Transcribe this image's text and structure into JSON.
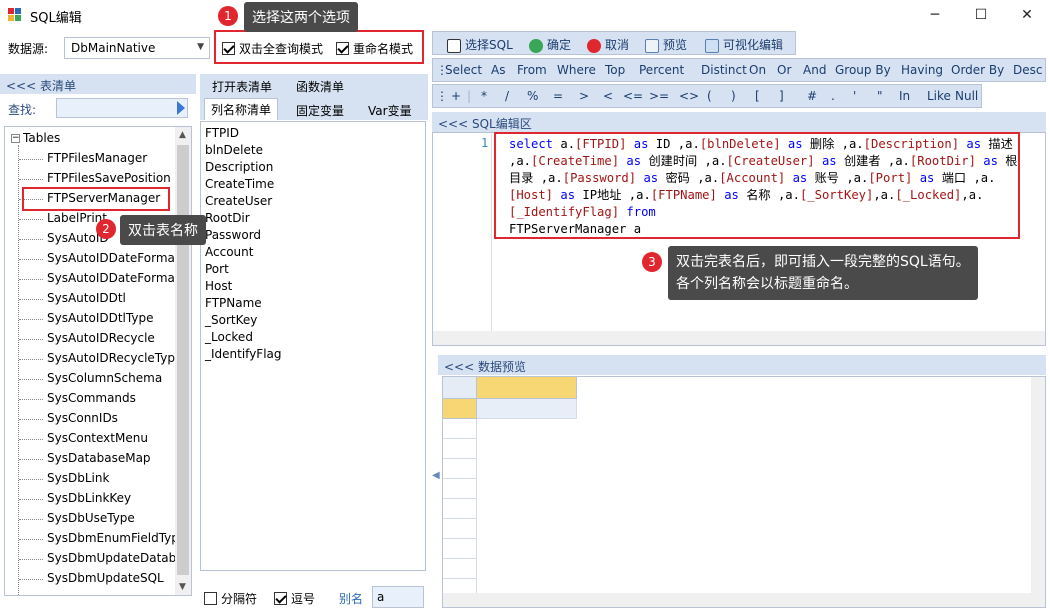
{
  "window": {
    "title": "SQL编辑",
    "controls": [
      "─",
      "☐",
      "✕"
    ]
  },
  "datasource": {
    "label": "数据源:",
    "value": "DbMainNative"
  },
  "options": {
    "fullquery_label": "双击全查询模式",
    "fullquery_checked": true,
    "rename_label": "重命名模式",
    "rename_checked": true
  },
  "tables_panel": {
    "title": "<<< 表清单",
    "find_label": "查找:",
    "root": "Tables",
    "items": [
      "FTPFilesManager",
      "FTPFilesSavePosition",
      "FTPServerManager",
      "LabelPrint",
      "SysAutoID",
      "SysAutoIDDateFormat",
      "SysAutoIDDateFormat",
      "SysAutoIDDtl",
      "SysAutoIDDtlType",
      "SysAutoIDRecycle",
      "SysAutoIDRecycleType",
      "SysColumnSchema",
      "SysCommands",
      "SysConnIDs",
      "SysContextMenu",
      "SysDatabaseMap",
      "SysDbLink",
      "SysDbLinkKey",
      "SysDbUseType",
      "SysDbmEnumFieldTyp",
      "SysDbmUpdateDataba",
      "SysDbmUpdateSQL"
    ]
  },
  "mid_tabs": {
    "t1": "打开表清单",
    "t2": "函数清单",
    "t3": "列名称清单",
    "t4": "固定变量",
    "t5": "Var变量"
  },
  "columns": [
    "FTPID",
    "blnDelete",
    "Description",
    "CreateTime",
    "CreateUser",
    "RootDir",
    "Password",
    "Account",
    "Port",
    "Host",
    "FTPName",
    "_SortKey",
    "_Locked",
    "_IdentifyFlag"
  ],
  "mid_bottom": {
    "sep_label": "分隔符",
    "sep_checked": false,
    "comma_label": "逗号",
    "comma_checked": true,
    "alias_label": "别名",
    "alias_value": "a"
  },
  "toolbar1": {
    "select_sql": "选择SQL",
    "ok": "确定",
    "cancel": "取消",
    "preview": "预览",
    "visual": "可视化编辑"
  },
  "keywords": [
    "Select",
    "As",
    "From",
    "Where",
    "Top",
    "Percent",
    "Distinct",
    "On",
    "Or",
    "And",
    "Group By",
    "Having",
    "Order By",
    "Desc"
  ],
  "operators": [
    "+",
    "*",
    "/",
    "%",
    "=",
    ">",
    "<",
    "<=",
    ">=",
    "<>",
    "(",
    ")",
    "[",
    "]",
    "#",
    ".",
    "'",
    "\"",
    "In",
    "Like",
    "Null"
  ],
  "sql_panel": {
    "title": "<<< SQL编辑区",
    "line": "1"
  },
  "preview_panel": {
    "title": "<<< 数据预览"
  },
  "callouts": {
    "n1": "1",
    "c1": "选择这两个选项",
    "n2": "2",
    "c2": "双击表名称",
    "n3": "3",
    "c3a": "双击完表名后，即可插入一段完整的SQL语句。",
    "c3b": "各个列名称会以标题重命名。"
  },
  "colors": {
    "accent": "#e0262e",
    "panel": "#d6e2f2",
    "keyword": "#0000ff",
    "field": "#a31515"
  }
}
